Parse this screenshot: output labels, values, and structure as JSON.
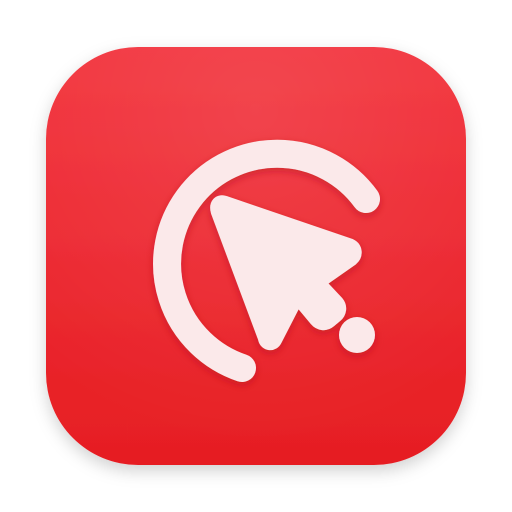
{
  "app_icon": {
    "icon_name": "cursor-click-icon",
    "colors": {
      "tile_top": "#F2323C",
      "tile_bottom": "#E61E23",
      "glyph": "#FBE9EA",
      "glyph_shadow": "#B8141B"
    }
  }
}
